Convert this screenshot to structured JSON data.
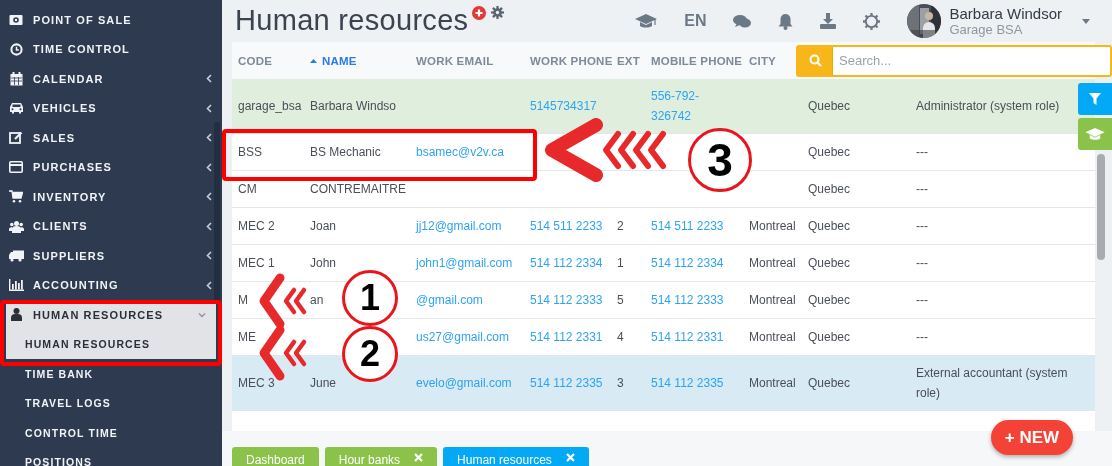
{
  "sidebar": {
    "items": [
      {
        "label": "POINT OF SALE",
        "submenu": false,
        "expanded": false
      },
      {
        "label": "TIME CONTROL",
        "submenu": false,
        "expanded": false
      },
      {
        "label": "CALENDAR",
        "submenu": true,
        "expanded": false
      },
      {
        "label": "VEHICLES",
        "submenu": true,
        "expanded": false
      },
      {
        "label": "SALES",
        "submenu": true,
        "expanded": false
      },
      {
        "label": "PURCHASES",
        "submenu": true,
        "expanded": false
      },
      {
        "label": "INVENTORY",
        "submenu": true,
        "expanded": false
      },
      {
        "label": "CLIENTS",
        "submenu": true,
        "expanded": false
      },
      {
        "label": "SUPPLIERS",
        "submenu": true,
        "expanded": false
      },
      {
        "label": "ACCOUNTING",
        "submenu": true,
        "expanded": false
      },
      {
        "label": "HUMAN RESOURCES",
        "submenu": true,
        "expanded": true,
        "children": [
          {
            "label": "HUMAN RESOURCES",
            "selected": true
          },
          {
            "label": "TIME BANK",
            "selected": false
          },
          {
            "label": "TRAVEL LOGS",
            "selected": false
          },
          {
            "label": "CONTROL TIME",
            "selected": false
          },
          {
            "label": "POSITIONS",
            "selected": false
          }
        ]
      }
    ]
  },
  "header": {
    "title": "Human resources",
    "language": "EN",
    "user": {
      "name": "Barbara Windsor",
      "company": "Garage BSA"
    }
  },
  "table": {
    "columns": [
      {
        "label": "CODE",
        "kind": "text",
        "sorted": false
      },
      {
        "label": "NAME",
        "kind": "text",
        "sorted": true
      },
      {
        "label": "WORK EMAIL",
        "kind": "link",
        "sorted": false
      },
      {
        "label": "WORK PHONE",
        "kind": "link",
        "sorted": false
      },
      {
        "label": "EXT",
        "kind": "text",
        "sorted": false
      },
      {
        "label": "MOBILE PHONE",
        "kind": "link",
        "sorted": false
      },
      {
        "label": "CITY",
        "kind": "text",
        "sorted": false
      },
      {
        "kind": "text"
      },
      {
        "kind": "text"
      }
    ],
    "search": {
      "placeholder": "Search..."
    },
    "rows": [
      {
        "color": "#dfeedd",
        "cells": [
          "garage_bsa",
          "Barbara Windso",
          null,
          "5145734317",
          null,
          "556-792-326742",
          null,
          "Quebec",
          "Administrator (system role)"
        ]
      },
      {
        "color": "#ffffff",
        "cells": [
          "BSS",
          "BS Mechanic",
          "bsamec@v2v.ca",
          null,
          null,
          null,
          null,
          "Quebec",
          "---"
        ]
      },
      {
        "color": "#ffffff",
        "cells": [
          "CM",
          "CONTREMAITRE",
          null,
          null,
          null,
          null,
          null,
          "Quebec",
          "---"
        ]
      },
      {
        "color": "#ffffff",
        "cells": [
          "MEC 2",
          "Joan",
          "jj12@gmail.com",
          "514 511 2233",
          "2",
          "514 511 2233",
          "Montreal",
          "Quebec",
          "---"
        ]
      },
      {
        "color": "#ffffff",
        "cells": [
          "MEC 1",
          "John",
          "john1@gmail.com",
          "514 112 2334",
          "1",
          "514 112 2334",
          "Montreal",
          "Quebec",
          "---"
        ]
      },
      {
        "color": "#ffffff",
        "cells": [
          "M",
          "an",
          "@gmail.com",
          "514 112 2333",
          "5",
          "514 112 2333",
          "Montreal",
          "Quebec",
          "---"
        ]
      },
      {
        "color": "#ffffff",
        "cells": [
          "ME",
          null,
          "us27@gmail.com",
          "514 112 2331",
          "4",
          "514 112 2331",
          "Montreal",
          "Quebec",
          "---"
        ]
      },
      {
        "color": "#d8eaf4",
        "cells": [
          "MEC 3",
          "June",
          "evelo@gmail.com",
          "514 112 2335",
          "3",
          "514 112 2335",
          "Montreal",
          "Quebec",
          "External accountant (system role)"
        ]
      }
    ]
  },
  "new_button": "+ NEW",
  "bottom_tabs": [
    {
      "label": "Dashboard",
      "closable": false,
      "selected": false
    },
    {
      "label": "Hour banks",
      "closable": true,
      "selected": false
    },
    {
      "label": "Human resources",
      "closable": true,
      "selected": true
    }
  ],
  "annotations": [
    {
      "kind": "frame"
    },
    {
      "kind": "frame"
    },
    {
      "kind": "arrow",
      "number": "3"
    },
    {
      "kind": "arrow",
      "number": "1"
    },
    {
      "kind": "arrow",
      "number": "2"
    }
  ]
}
